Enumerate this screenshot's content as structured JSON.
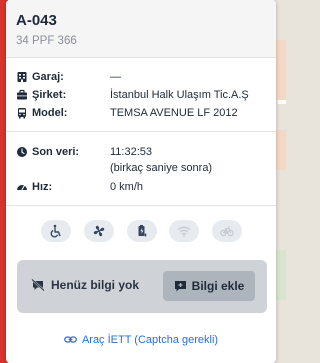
{
  "vehicle": {
    "id": "A-043",
    "plate": "34 PPF 366"
  },
  "details": [
    {
      "label": "Garaj:",
      "value": "—",
      "icon": "building-icon"
    },
    {
      "label": "Şirket:",
      "value": "İstanbul Halk Ulaşım Tic.A.Ş",
      "icon": "briefcase-icon"
    },
    {
      "label": "Model:",
      "value": "TEMSA AVENUE LF 2012",
      "icon": "bus-icon"
    }
  ],
  "status": {
    "last_data_label": "Son veri:",
    "last_data_time": "11:32:53",
    "last_data_relative": "(birkaç saniye sonra)",
    "speed_label": "Hız:",
    "speed_value": "0 km/h"
  },
  "features": [
    {
      "name": "wheelchair-icon",
      "available": true
    },
    {
      "name": "fan-icon",
      "available": true
    },
    {
      "name": "charging-icon",
      "available": true
    },
    {
      "name": "wifi-icon",
      "available": false
    },
    {
      "name": "bicycle-icon",
      "available": false
    }
  ],
  "info": {
    "no_data_text": "Henüz bilgi yok",
    "add_button_label": "Bilgi ekle"
  },
  "footer": {
    "link_text": "Araç İETT (Captcha gerekli)"
  },
  "colors": {
    "accent": "#d9342b",
    "link": "#2b6fd6",
    "text": "#1f2a3a"
  }
}
